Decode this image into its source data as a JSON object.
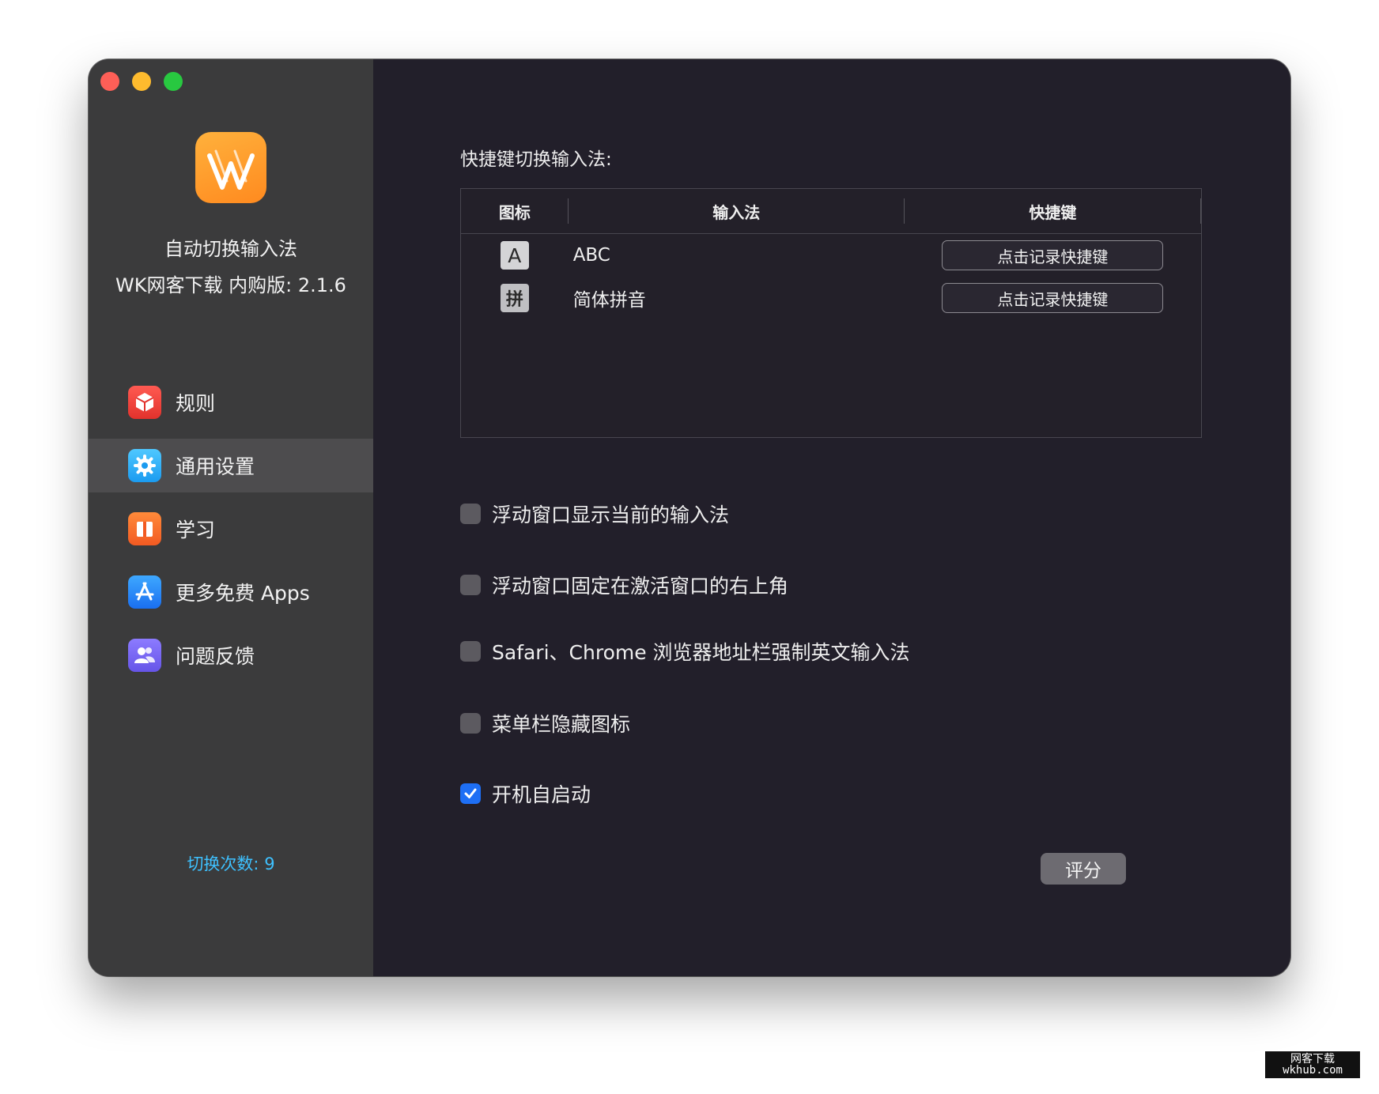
{
  "app": {
    "name": "自动切换输入法",
    "version_line": "WK网客下载 内购版: 2.1.6"
  },
  "sidebar": {
    "items": [
      {
        "label": "规则",
        "icon": "cube-icon",
        "active": false
      },
      {
        "label": "通用设置",
        "icon": "gear-icon",
        "active": true
      },
      {
        "label": "学习",
        "icon": "book-icon",
        "active": false
      },
      {
        "label": "更多免费 Apps",
        "icon": "app-store-icon",
        "active": false
      },
      {
        "label": "问题反馈",
        "icon": "users-icon",
        "active": false
      }
    ],
    "switch_count": "切换次数: 9"
  },
  "shortcuts": {
    "title": "快捷键切换输入法:",
    "columns": [
      "图标",
      "输入法",
      "快捷键"
    ],
    "rows": [
      {
        "icon_text": "A",
        "input_method": "ABC",
        "button": "点击记录快捷键"
      },
      {
        "icon_text": "拼",
        "input_method": "简体拼音",
        "button": "点击记录快捷键"
      }
    ]
  },
  "options": [
    {
      "label": "浮动窗口显示当前的输入法",
      "checked": false
    },
    {
      "label": "浮动窗口固定在激活窗口的右上角",
      "checked": false
    },
    {
      "label": "Safari、Chrome 浏览器地址栏强制英文输入法",
      "checked": false
    },
    {
      "label": "菜单栏隐藏图标",
      "checked": false
    },
    {
      "label": "开机自启动",
      "checked": true
    }
  ],
  "rate_button": "评分",
  "watermark": {
    "line1": "网客下载",
    "line2": "wkhub.com"
  },
  "colors": {
    "accent": "#1e6ff5",
    "count_text": "#3ec1ff",
    "sidebar_bg": "#3b3b3c",
    "main_bg": "#221f2a"
  }
}
